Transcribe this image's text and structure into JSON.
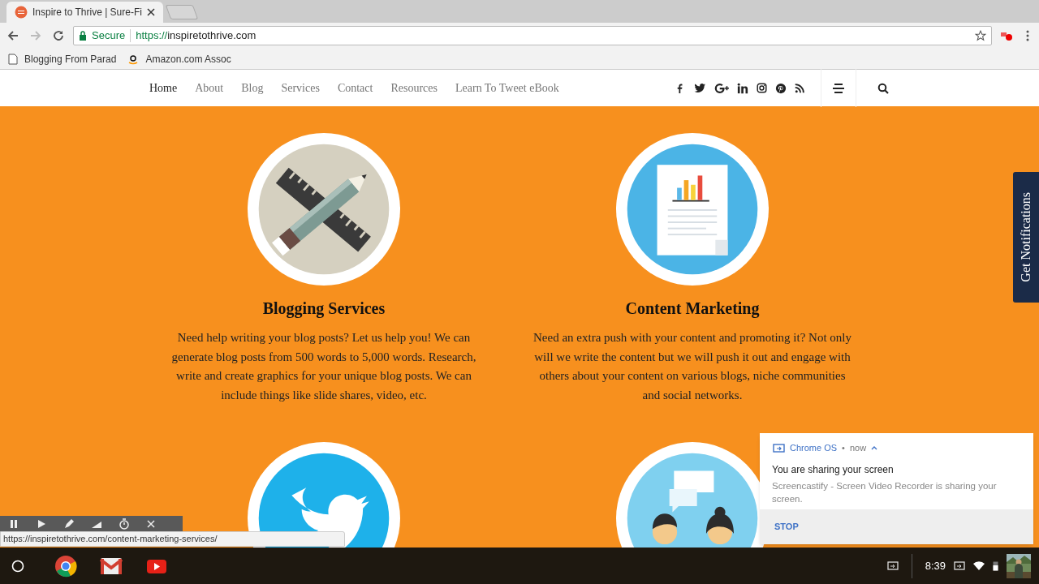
{
  "browser": {
    "tab_title": "Inspire to Thrive | Sure-Fi",
    "secure_label": "Secure",
    "url_scheme": "https://",
    "url_host": "inspiretothrive.com",
    "bookmarks": [
      {
        "label": "Blogging From Parad",
        "kind": "page"
      },
      {
        "label": "Amazon.com Assoc",
        "kind": "amazon"
      }
    ]
  },
  "site_nav": {
    "items": [
      {
        "label": "Home",
        "selected": true
      },
      {
        "label": "About",
        "selected": false
      },
      {
        "label": "Blog",
        "selected": false
      },
      {
        "label": "Services",
        "selected": false
      },
      {
        "label": "Contact",
        "selected": false
      },
      {
        "label": "Resources",
        "selected": false
      },
      {
        "label": "Learn To Tweet eBook",
        "selected": false
      }
    ]
  },
  "services": [
    {
      "kind": "pencil-ruler",
      "title": "Blogging Services",
      "text": "Need help writing your blog posts? Let us help you! We can generate blog posts from 500 words to 5,000 words. Research, write and create graphics for your unique blog posts. We can include things like slide shares, video, etc."
    },
    {
      "kind": "document-chart",
      "title": "Content Marketing",
      "text": "Need an extra push with your content and promoting it? Not only will we write the content but we will push it out and engage with others about your content on various blogs, niche communities and social networks."
    },
    {
      "kind": "bird"
    },
    {
      "kind": "people"
    }
  ],
  "notifications_tab": {
    "label": "Get Notifications"
  },
  "notification": {
    "source": "Chrome OS",
    "separator": "•",
    "time": "now",
    "title": "You are sharing your screen",
    "body": "Screencastify - Screen Video Recorder is sharing your screen.",
    "action": "STOP"
  },
  "status_url": "https://inspiretothrive.com/content-marketing-services/",
  "shelf": {
    "apps": [
      {
        "kind": "chrome"
      },
      {
        "kind": "gmail"
      },
      {
        "kind": "youtube"
      }
    ],
    "time": "8:39"
  }
}
